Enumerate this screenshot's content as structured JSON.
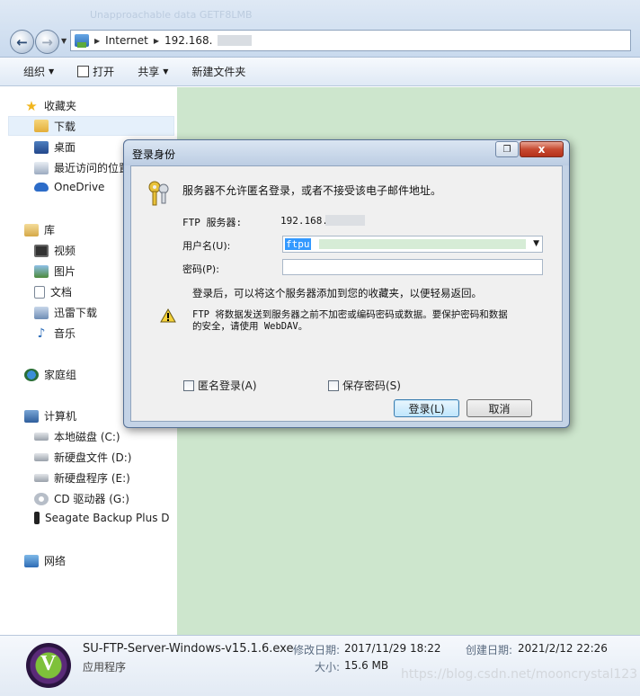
{
  "window": {
    "ghost_text": "Unapproachable  data  GETF8LMB"
  },
  "address_bar": {
    "crumbs": [
      "Internet",
      "192.168."
    ]
  },
  "toolbar": {
    "organize": "组织",
    "open": "打开",
    "share": "共享",
    "new_folder": "新建文件夹"
  },
  "nav": {
    "favorites": "收藏夹",
    "downloads": "下载",
    "desktop": "桌面",
    "recent": "最近访问的位置",
    "onedrive": "OneDrive",
    "libraries": "库",
    "videos": "视频",
    "pictures": "图片",
    "documents": "文档",
    "xunlei": "迅雷下载",
    "music": "音乐",
    "homegroup": "家庭组",
    "computer": "计算机",
    "drive_c": "本地磁盘 (C:)",
    "drive_d": "新硬盘文件 (D:)",
    "drive_e": "新硬盘程序 (E:)",
    "drive_g": "CD 驱动器 (G:)",
    "seagate": "Seagate Backup Plus D",
    "network": "网络"
  },
  "dialog": {
    "title": "登录身份",
    "message": "服务器不允许匿名登录，或者不接受该电子邮件地址。",
    "server_label": "FTP 服务器:",
    "server_value": "192.168.",
    "username_label": "用户名(U):",
    "username_value": "ftpu",
    "password_label": "密码(P):",
    "password_value": "",
    "info_text": "登录后，可以将这个服务器添加到您的收藏夹，以便轻易返回。",
    "warning_line1": "FTP 将数据发送到服务器之前不加密或编码密码或数据。要保护密码和数据",
    "warning_line2": "的安全，请使用 WebDAV。",
    "anonymous_label": "匿名登录(A)",
    "anonymous_checked": false,
    "save_password_label": "保存密码(S)",
    "save_password_checked": false,
    "login_button": "登录(L)",
    "cancel_button": "取消",
    "close_glyph": "x"
  },
  "details": {
    "file_name": "SU-FTP-Server-Windows-v15.1.6.exe",
    "file_type": "应用程序",
    "modified_label": "修改日期:",
    "modified_value": "2017/11/29 18:22",
    "created_label": "创建日期:",
    "created_value": "2021/2/12 22:26",
    "size_label": "大小:",
    "size_value": "15.6 MB"
  },
  "watermark": "https://blog.csdn.net/mooncrystal123",
  "colors": {
    "content_bg": "#cde6cd",
    "close_button": "#c74a31"
  }
}
